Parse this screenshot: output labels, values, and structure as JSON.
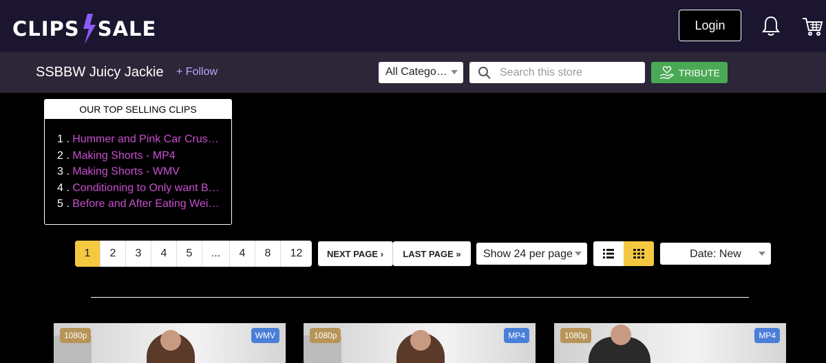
{
  "header": {
    "logo_left": "CLIPS",
    "logo_right": "SALE",
    "login_label": "Login"
  },
  "store": {
    "name": "SSBBW Juicy Jackie",
    "follow_label": "+ Follow",
    "category_select": "All Catego…",
    "search_placeholder": "Search this store",
    "tribute_label": "TRIBUTE"
  },
  "top_selling": {
    "title": "OUR TOP SELLING CLIPS",
    "items": [
      {
        "num": "1 .",
        "label": "Hummer and Pink Car Crus…"
      },
      {
        "num": "2 .",
        "label": "Making Shorts - MP4"
      },
      {
        "num": "3 .",
        "label": "Making Shorts - WMV"
      },
      {
        "num": "4 .",
        "label": "Conditioning to Only want B…"
      },
      {
        "num": "5 .",
        "label": "Before and After Eating Wei…"
      }
    ]
  },
  "pagination": {
    "pages": [
      "1",
      "2",
      "3",
      "4",
      "5",
      "...",
      "4",
      "8",
      "12"
    ],
    "active": "1",
    "next_label": "NEXT PAGE ›",
    "last_label": "LAST PAGE »",
    "per_page": "Show 24 per page",
    "sort": "Date: New"
  },
  "clips": [
    {
      "resolution": "1080p",
      "format": "WMV"
    },
    {
      "resolution": "1080p",
      "format": "MP4"
    },
    {
      "resolution": "1080p",
      "format": "MP4"
    }
  ],
  "colors": {
    "header_bg": "#1c1530",
    "storebar_bg": "#2d2638",
    "accent_yellow": "#f5c842",
    "follow_purple": "#b9a9ff",
    "link_magenta": "#c94fd0",
    "tribute_green": "#4aa955",
    "badge_res": "#b79457",
    "badge_fmt": "#4a7fd9"
  },
  "icons": {
    "logo": "lightning-bolt-icon",
    "notifications": "bell-icon",
    "cart": "cart-icon",
    "search": "search-icon",
    "tribute": "heart-hand-icon",
    "list_view": "list-view-icon",
    "grid_view": "grid-view-icon"
  }
}
